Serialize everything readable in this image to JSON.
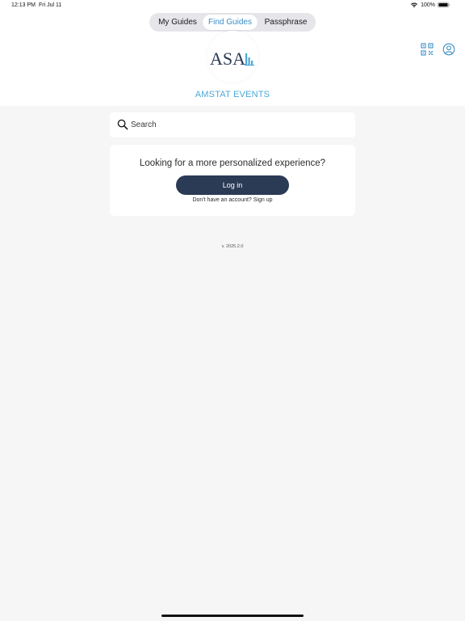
{
  "status_bar": {
    "time": "12:13 PM",
    "date": "Fri Jul 11",
    "battery": "100%"
  },
  "tabs": [
    {
      "label": "My Guides",
      "selected": false
    },
    {
      "label": "Find Guides",
      "selected": true
    },
    {
      "label": "Passphrase",
      "selected": false
    }
  ],
  "logo": {
    "text": "ASA",
    "icon": "asa-logo"
  },
  "organization": {
    "title": "AMSTAT EVENTS"
  },
  "search": {
    "placeholder": "Search",
    "value": ""
  },
  "login_card": {
    "prompt": "Looking for a more personalized experience?",
    "login_label": "Log in",
    "signup_text": "Don't have an account? Sign up"
  },
  "footer": {
    "version": "v. 2025.2.0"
  },
  "icons": {
    "qr": "qr-code-icon",
    "profile": "profile-icon",
    "search": "search-icon",
    "wifi": "wifi-icon",
    "battery": "battery-icon"
  },
  "colors": {
    "accent": "#3a8ec7",
    "title": "#4aa8d8",
    "button": "#2b3a55",
    "background": "#f6f6f6"
  }
}
